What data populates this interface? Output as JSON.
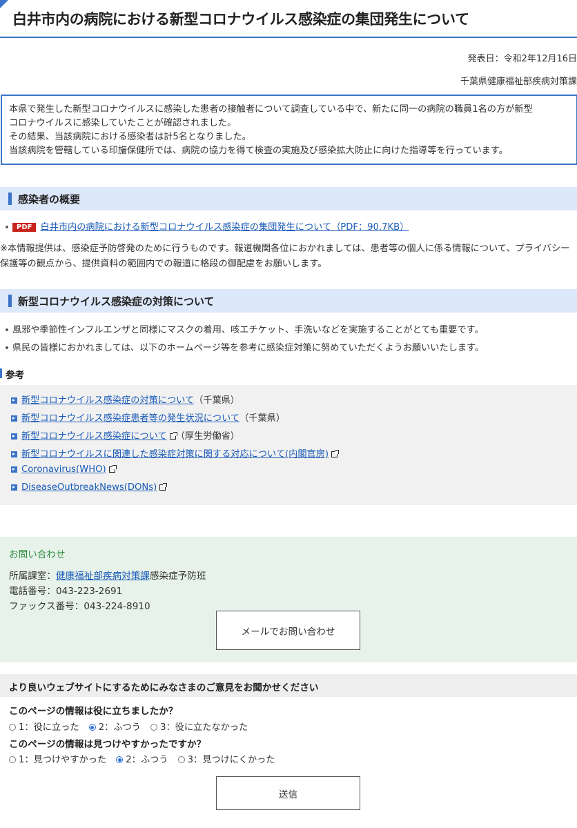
{
  "page": {
    "title": "白井市内の病院における新型コロナウイルス感染症の集団発生について",
    "date": "発表日：令和2年12月16日",
    "department": "千葉県健康福祉部疾病対策課"
  },
  "summary": {
    "lines": [
      "本県で発生した新型コロナウイルスに感染した患者の接触者について調査している中で、新たに同一の病院の職員1名の方が新型",
      "コロナウイルスに感染していたことが確認されました。",
      "その結果、当該病院における感染者は計5名となりました。",
      "当該病院を管轄している印旛保健所では、病院の協力を得て検査の実施及び感染拡大防止に向けた指導等を行っています。"
    ]
  },
  "section1": {
    "heading": "感染者の概要",
    "pdf_badge": "PDF",
    "pdf_link": "白井市内の病院における新型コロナウイルス感染症の集団発生について（PDF：90.7KB）",
    "note": "※本情報提供は、感染症予防啓発のために行うものです。報道機関各位におかれましては、患者等の個人に係る情報について、プライバシー保護等の観点から、提供資料の範囲内での報道に格段の御配慮をお願いします。"
  },
  "section2": {
    "heading": "新型コロナウイルス感染症の対策について",
    "bullets": [
      "風邪や季節性インフルエンザと同様にマスクの着用、咳エチケット、手洗いなどを実施することがとても重要です。",
      "県民の皆様におかれましては、以下のホームページ等を参考に感染症対策に努めていただくようお願いいたします。"
    ]
  },
  "references": {
    "label": "参考",
    "items": [
      {
        "link": "新型コロナウイルス感染症の対策について",
        "suffix": "（千葉県）"
      },
      {
        "link": "新型コロナウイルス感染症患者等の発生状況について",
        "suffix": "（千葉県）"
      },
      {
        "link": "新型コロナウイルス感染症について",
        "suffix": "（厚生労働省）"
      },
      {
        "link": "新型コロナウイルスに関連した感染症対策に関する対応について(内閣官房)",
        "suffix": ""
      },
      {
        "link": "Coronavirus(WHO)",
        "suffix": ""
      },
      {
        "link": "DiseaseOutbreakNews(DONs)",
        "suffix": ""
      }
    ]
  },
  "contact": {
    "heading": "お問い合わせ",
    "dept_label": "所属課室：",
    "dept_link": "健康福祉部疾病対策課",
    "dept_suffix": "感染症予防班",
    "phone": "電話番号：043-223-2691",
    "fax": "ファックス番号：043-224-8910",
    "mail_button": "メールでお問い合わせ"
  },
  "survey": {
    "heading": "より良いウェブサイトにするためにみなさまのご意見をお聞かせください",
    "q1": "このページの情報は役に立ちましたか？",
    "q1_options": [
      "1：役に立った",
      "2：ふつう",
      "3：役に立たなかった"
    ],
    "q2": "このページの情報は見つけやすかったですか？",
    "q2_options": [
      "1：見つけやすかった",
      "2：ふつう",
      "3：見つけにくかった"
    ],
    "submit": "送信"
  }
}
